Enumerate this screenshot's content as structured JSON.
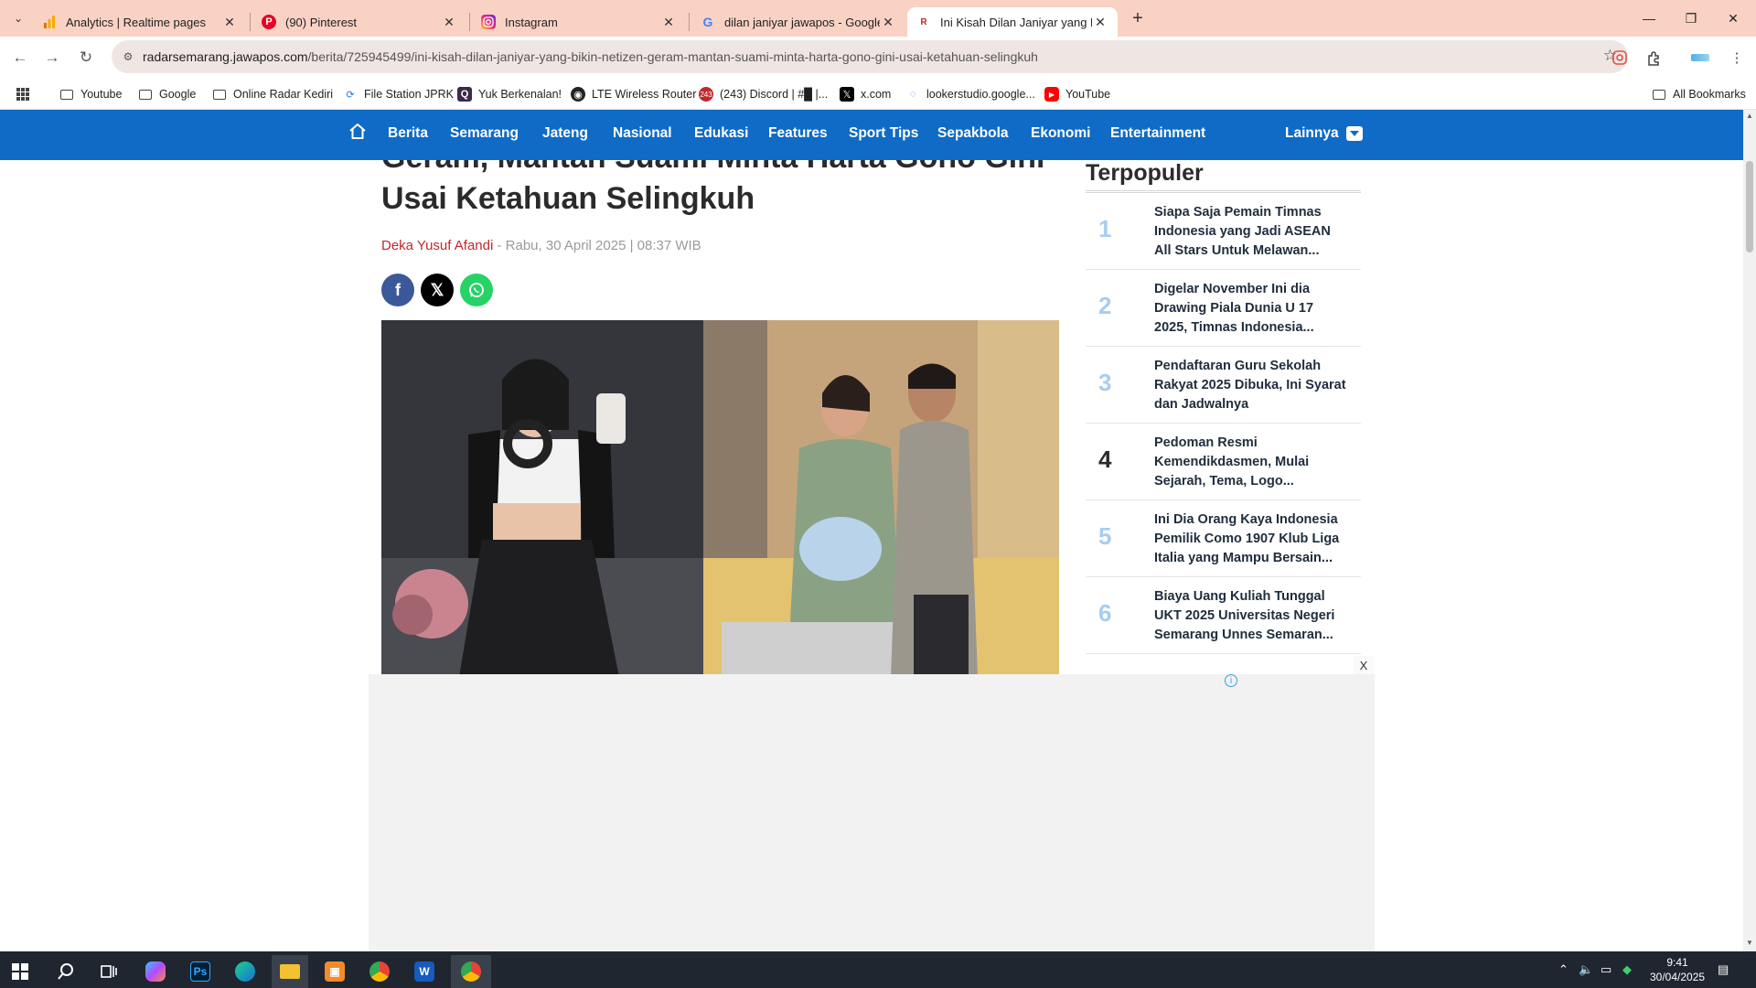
{
  "browser": {
    "tabs": [
      {
        "title": "Analytics | Realtime pages",
        "favicon": "analytics-icon",
        "color": "#f9ab00"
      },
      {
        "title": "(90) Pinterest",
        "favicon": "pinterest-icon",
        "color": "#e60023"
      },
      {
        "title": "Instagram",
        "favicon": "instagram-icon",
        "color": "#d6249f"
      },
      {
        "title": "dilan janiyar jawapos - Google S",
        "favicon": "google-icon",
        "color": "#4285f4"
      },
      {
        "title": "Ini Kisah Dilan Janiyar yang Bikin",
        "favicon": "radar-icon",
        "color": "#c0282d"
      }
    ],
    "url_host": "radarsemarang.jawapos.com",
    "url_path": "/berita/725945499/ini-kisah-dilan-janiyar-yang-bikin-netizen-geram-mantan-suami-minta-harta-gono-gini-usai-ketahuan-selingkuh",
    "bookmarks": [
      {
        "label": "Youtube",
        "icon": "folder-icon"
      },
      {
        "label": "Google",
        "icon": "folder-icon"
      },
      {
        "label": "Online Radar Kediri",
        "icon": "folder-icon"
      },
      {
        "label": "File Station JPRK",
        "icon": "file-station-icon"
      },
      {
        "label": "Yuk Berkenalan!",
        "icon": "q-icon"
      },
      {
        "label": "LTE Wireless Router",
        "icon": "globe-icon"
      },
      {
        "label": "(243) Discord | #█ |...",
        "icon": "discord-icon"
      },
      {
        "label": "x.com",
        "icon": "x-icon"
      },
      {
        "label": "lookerstudio.google...",
        "icon": "looker-icon"
      },
      {
        "label": "YouTube",
        "icon": "youtube-icon"
      }
    ],
    "all_bookmarks": "All Bookmarks"
  },
  "site": {
    "nav": [
      "Berita",
      "Semarang",
      "Jateng",
      "Nasional",
      "Edukasi",
      "Features",
      "Sport Tips",
      "Sepakbola",
      "Ekonomi",
      "Entertainment"
    ],
    "more": "Lainnya",
    "brand_color": "#0f6bc6"
  },
  "article": {
    "headline_line1": "Geram, Mantan Suami Minta Harta Gono Gini",
    "headline_line2": "Usai Ketahuan Selingkuh",
    "author": "Deka Yusuf Afandi",
    "date": " - Rabu, 30 April 2025 | 08:37 WIB"
  },
  "sidebar": {
    "title": "Terpopuler",
    "items": [
      {
        "num": "1",
        "text": "Siapa Saja Pemain Timnas Indonesia yang Jadi ASEAN All Stars Untuk Melawan..."
      },
      {
        "num": "2",
        "text": "Digelar November Ini dia Drawing Piala Dunia U 17 2025, Timnas Indonesia..."
      },
      {
        "num": "3",
        "text": "Pendaftaran Guru Sekolah Rakyat 2025 Dibuka, Ini Syarat dan Jadwalnya"
      },
      {
        "num": "4",
        "text": "Pedoman Resmi Kemendikdasmen, Mulai Sejarah, Tema, Logo..."
      },
      {
        "num": "5",
        "text": "Ini Dia Orang Kaya Indonesia Pemilik Como 1907 Klub Liga Italia yang Mampu Bersain..."
      },
      {
        "num": "6",
        "text": "Biaya Uang Kuliah Tunggal UKT 2025 Universitas Negeri Semarang Unnes Semaran..."
      }
    ]
  },
  "ad": {
    "close": "X",
    "info": "i"
  },
  "taskbar": {
    "time": "9:41",
    "date": "30/04/2025"
  }
}
